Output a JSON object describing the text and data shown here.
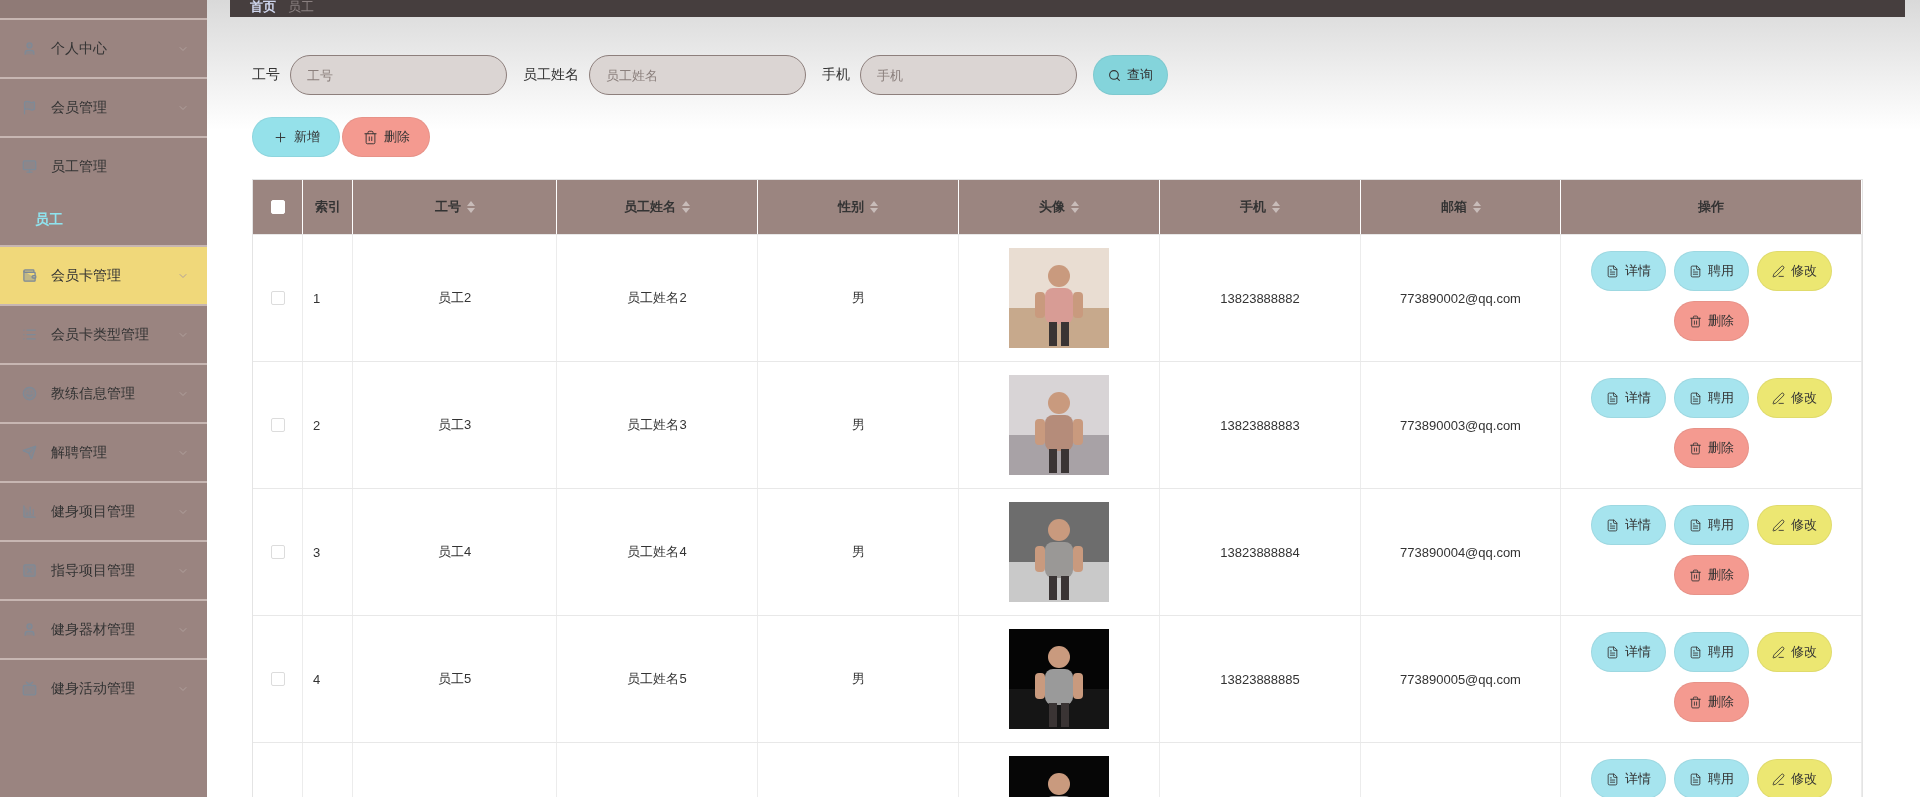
{
  "sidebar": {
    "items": [
      {
        "label": "个人中心",
        "hovered": false,
        "expanded": false
      },
      {
        "label": "会员管理",
        "hovered": false,
        "expanded": false
      },
      {
        "label": "员工管理",
        "hovered": false,
        "expanded": true,
        "children": [
          {
            "label": "员工",
            "selected": true
          }
        ]
      },
      {
        "label": "会员卡管理",
        "hovered": true,
        "expanded": false
      },
      {
        "label": "会员卡类型管理",
        "hovered": false,
        "expanded": false
      },
      {
        "label": "教练信息管理",
        "hovered": false,
        "expanded": false
      },
      {
        "label": "解聘管理",
        "hovered": false,
        "expanded": false
      },
      {
        "label": "健身项目管理",
        "hovered": false,
        "expanded": false
      },
      {
        "label": "指导项目管理",
        "hovered": false,
        "expanded": false
      },
      {
        "label": "健身器材管理",
        "hovered": false,
        "expanded": false
      },
      {
        "label": "健身活动管理",
        "hovered": false,
        "expanded": false
      }
    ]
  },
  "breadcrumb": [
    "首页",
    "员工"
  ],
  "search": {
    "fields": [
      {
        "label": "工号",
        "placeholder": "工号"
      },
      {
        "label": "员工姓名",
        "placeholder": "员工姓名"
      },
      {
        "label": "手机",
        "placeholder": "手机"
      }
    ],
    "button": "查询"
  },
  "toolbar": [
    {
      "kind": "add",
      "label": "新增"
    },
    {
      "kind": "delete",
      "label": "删除"
    }
  ],
  "table": {
    "select_all": {
      "checked": false
    },
    "columns": [
      {
        "label": "索引",
        "sortable": false
      },
      {
        "label": "工号",
        "sortable": true
      },
      {
        "label": "员工姓名",
        "sortable": true
      },
      {
        "label": "性别",
        "sortable": true
      },
      {
        "label": "头像",
        "sortable": true
      },
      {
        "label": "手机",
        "sortable": true
      },
      {
        "label": "邮箱",
        "sortable": true
      },
      {
        "label": "操作",
        "sortable": false
      }
    ],
    "rows": [
      {
        "checked": false,
        "index": "1",
        "id": "员工2",
        "name": "员工姓名2",
        "gender": "男",
        "avatar": {
          "kind": "picture"
        },
        "phone": "13823888882",
        "email": "773890002@qq.com",
        "actions": [
          {
            "kind": "detail",
            "label": "详情"
          },
          {
            "kind": "hire",
            "label": "聘用"
          },
          {
            "kind": "edit",
            "label": "修改"
          },
          {
            "kind": "delete",
            "label": "删除"
          }
        ]
      },
      {
        "checked": false,
        "index": "2",
        "id": "员工3",
        "name": "员工姓名3",
        "gender": "男",
        "avatar": {
          "kind": "picture"
        },
        "phone": "13823888883",
        "email": "773890003@qq.com",
        "actions": [
          {
            "kind": "detail",
            "label": "详情"
          },
          {
            "kind": "hire",
            "label": "聘用"
          },
          {
            "kind": "edit",
            "label": "修改"
          },
          {
            "kind": "delete",
            "label": "删除"
          }
        ]
      },
      {
        "checked": false,
        "index": "3",
        "id": "员工4",
        "name": "员工姓名4",
        "gender": "男",
        "avatar": {
          "kind": "picture"
        },
        "phone": "13823888884",
        "email": "773890004@qq.com",
        "actions": [
          {
            "kind": "detail",
            "label": "详情"
          },
          {
            "kind": "hire",
            "label": "聘用"
          },
          {
            "kind": "edit",
            "label": "修改"
          },
          {
            "kind": "delete",
            "label": "删除"
          }
        ]
      },
      {
        "checked": false,
        "index": "4",
        "id": "员工5",
        "name": "员工姓名5",
        "gender": "男",
        "avatar": {
          "kind": "picture"
        },
        "phone": "13823888885",
        "email": "773890005@qq.com",
        "actions": [
          {
            "kind": "detail",
            "label": "详情"
          },
          {
            "kind": "hire",
            "label": "聘用"
          },
          {
            "kind": "edit",
            "label": "修改"
          },
          {
            "kind": "delete",
            "label": "删除"
          }
        ]
      },
      {
        "avatar": {
          "kind": "picture"
        },
        "actions": [
          {
            "kind": "detail",
            "label": "详情"
          },
          {
            "kind": "hire",
            "label": "聘用"
          },
          {
            "kind": "edit",
            "label": "修改"
          }
        ]
      }
    ]
  }
}
